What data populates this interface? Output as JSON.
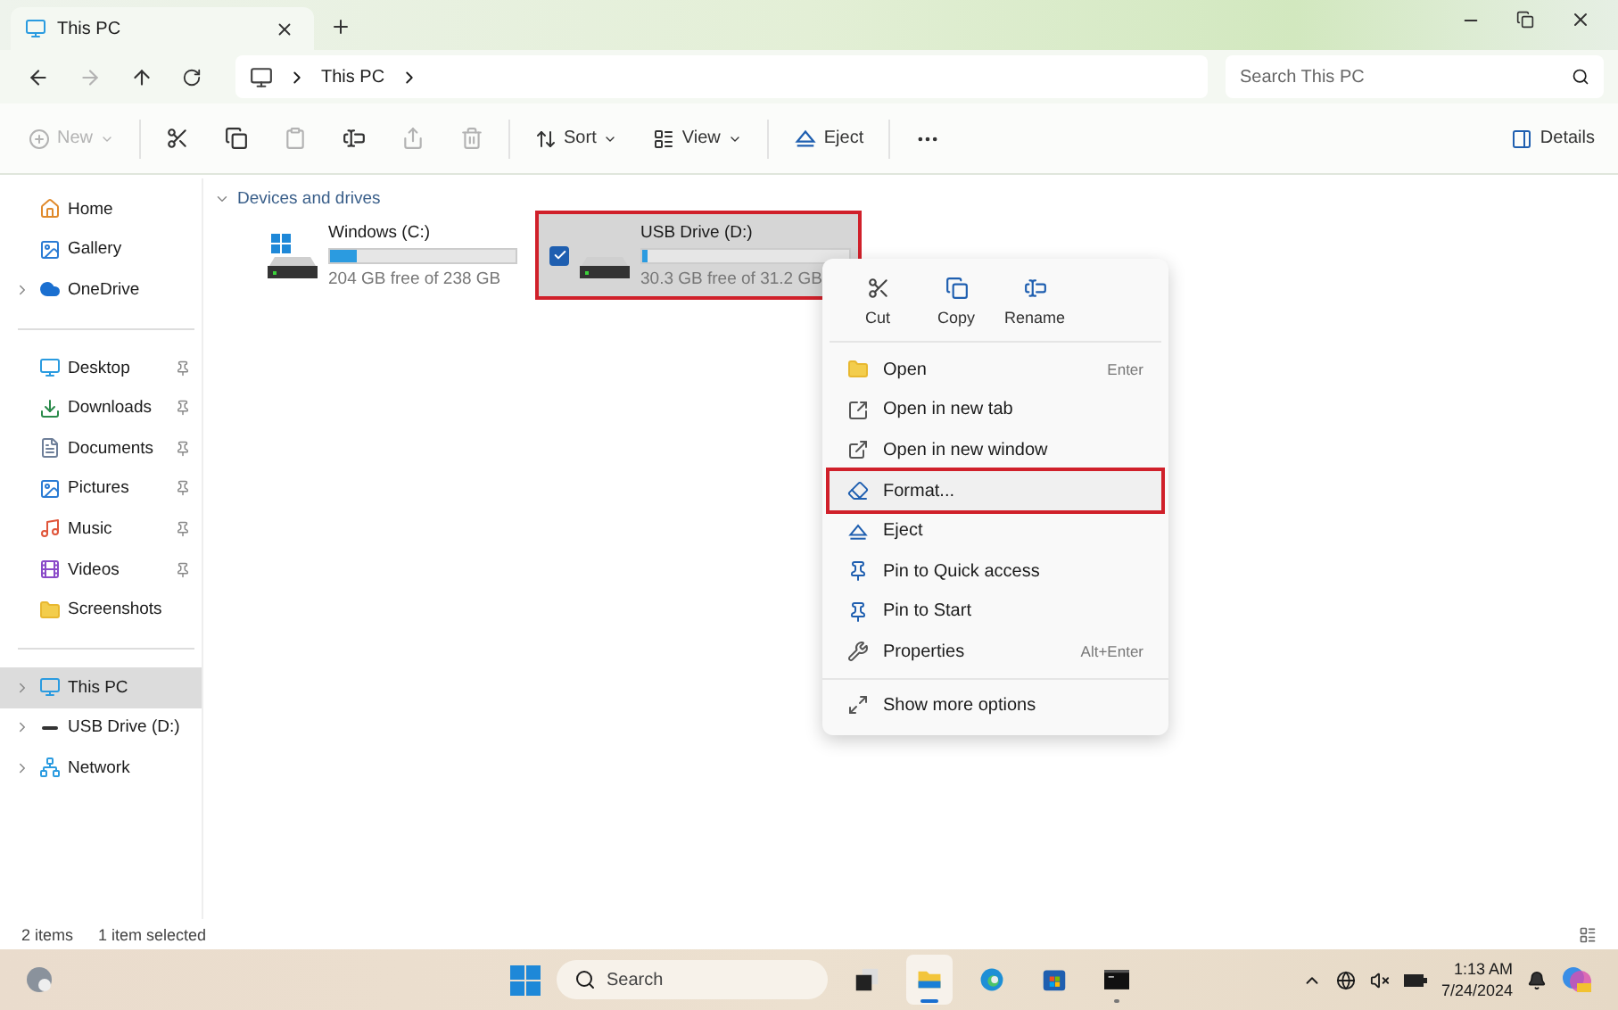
{
  "tabs": [
    {
      "title": "This PC",
      "selected": true
    }
  ],
  "address": {
    "crumbs": [
      "This PC"
    ]
  },
  "search": {
    "placeholder": "Search This PC"
  },
  "toolbar": {
    "items": [
      {
        "kind": "new",
        "label": "New",
        "disabled": true
      },
      {
        "kind": "cut",
        "disabled": false
      },
      {
        "kind": "copy",
        "disabled": false
      },
      {
        "kind": "paste",
        "disabled": true
      },
      {
        "kind": "rename",
        "disabled": false
      },
      {
        "kind": "share",
        "disabled": true
      },
      {
        "kind": "delete",
        "disabled": true
      },
      {
        "kind": "sort",
        "label": "Sort",
        "disabled": false
      },
      {
        "kind": "view",
        "label": "View",
        "disabled": false
      },
      {
        "kind": "eject",
        "label": "Eject",
        "disabled": false
      },
      {
        "kind": "more",
        "disabled": false
      }
    ],
    "details": "Details"
  },
  "sidebar": {
    "groups": [
      [
        {
          "kind": "home",
          "label": "Home",
          "pinned": false,
          "expandable": false,
          "selected": false
        },
        {
          "kind": "gallery",
          "label": "Gallery",
          "pinned": false,
          "expandable": false,
          "selected": false
        },
        {
          "kind": "cloud",
          "label": "OneDrive",
          "pinned": false,
          "expandable": true,
          "selected": false
        }
      ],
      [
        {
          "kind": "desktop",
          "label": "Desktop",
          "pinned": true,
          "expandable": false,
          "selected": false
        },
        {
          "kind": "downloads",
          "label": "Downloads",
          "pinned": true,
          "expandable": false,
          "selected": false
        },
        {
          "kind": "documents",
          "label": "Documents",
          "pinned": true,
          "expandable": false,
          "selected": false
        },
        {
          "kind": "pictures",
          "label": "Pictures",
          "pinned": true,
          "expandable": false,
          "selected": false
        },
        {
          "kind": "music",
          "label": "Music",
          "pinned": true,
          "expandable": false,
          "selected": false
        },
        {
          "kind": "videos",
          "label": "Videos",
          "pinned": true,
          "expandable": false,
          "selected": false
        },
        {
          "kind": "folder",
          "label": "Screenshots",
          "pinned": false,
          "expandable": false,
          "selected": false
        }
      ],
      [
        {
          "kind": "pc",
          "label": "This PC",
          "pinned": false,
          "expandable": true,
          "selected": true
        },
        {
          "kind": "usb",
          "label": "USB Drive (D:)",
          "pinned": false,
          "expandable": true,
          "selected": false
        },
        {
          "kind": "network",
          "label": "Network",
          "pinned": false,
          "expandable": true,
          "selected": false
        }
      ]
    ]
  },
  "section": {
    "title": "Devices and drives",
    "expanded": true
  },
  "drives": [
    {
      "kind": "system",
      "name": "Windows (C:)",
      "free": "204 GB free of 238 GB",
      "level": 0.14,
      "selected": false,
      "checked": false,
      "highlighted": false
    },
    {
      "kind": "usb",
      "name": "USB Drive (D:)",
      "free": "30.3 GB free of 31.2 GB",
      "level": 0.03,
      "selected": true,
      "checked": true,
      "highlighted": true
    }
  ],
  "context_menu": {
    "quick": [
      {
        "kind": "cut",
        "label": "Cut"
      },
      {
        "kind": "copy",
        "label": "Copy"
      },
      {
        "kind": "rename",
        "label": "Rename"
      }
    ],
    "items": [
      {
        "kind": "open",
        "label": "Open",
        "shortcut": "Enter",
        "highlighted": false
      },
      {
        "kind": "newtab",
        "label": "Open in new tab",
        "highlighted": false
      },
      {
        "kind": "newwindow",
        "label": "Open in new window",
        "highlighted": false
      },
      {
        "kind": "format",
        "label": "Format...",
        "highlighted": true
      },
      {
        "kind": "eject",
        "label": "Eject",
        "highlighted": false
      },
      {
        "kind": "pin",
        "label": "Pin to Quick access",
        "highlighted": false
      },
      {
        "kind": "pin",
        "label": "Pin to Start",
        "highlighted": false
      },
      {
        "kind": "properties",
        "label": "Properties",
        "shortcut": "Alt+Enter",
        "highlighted": false
      },
      {
        "kind": "more",
        "label": "Show more options",
        "highlighted": false
      }
    ]
  },
  "status_bar": {
    "count": "2 items",
    "selection": "1 item selected"
  },
  "taskbar": {
    "search": {
      "placeholder": "Search"
    },
    "apps": [
      {
        "kind": "taskview",
        "active": false,
        "running": false
      },
      {
        "kind": "explorer",
        "active": true,
        "running": true
      },
      {
        "kind": "edge",
        "active": false,
        "running": false
      },
      {
        "kind": "store",
        "active": false,
        "running": false
      },
      {
        "kind": "terminal",
        "active": false,
        "running": true
      }
    ],
    "time": "1:13 AM",
    "date": "7/24/2024"
  }
}
